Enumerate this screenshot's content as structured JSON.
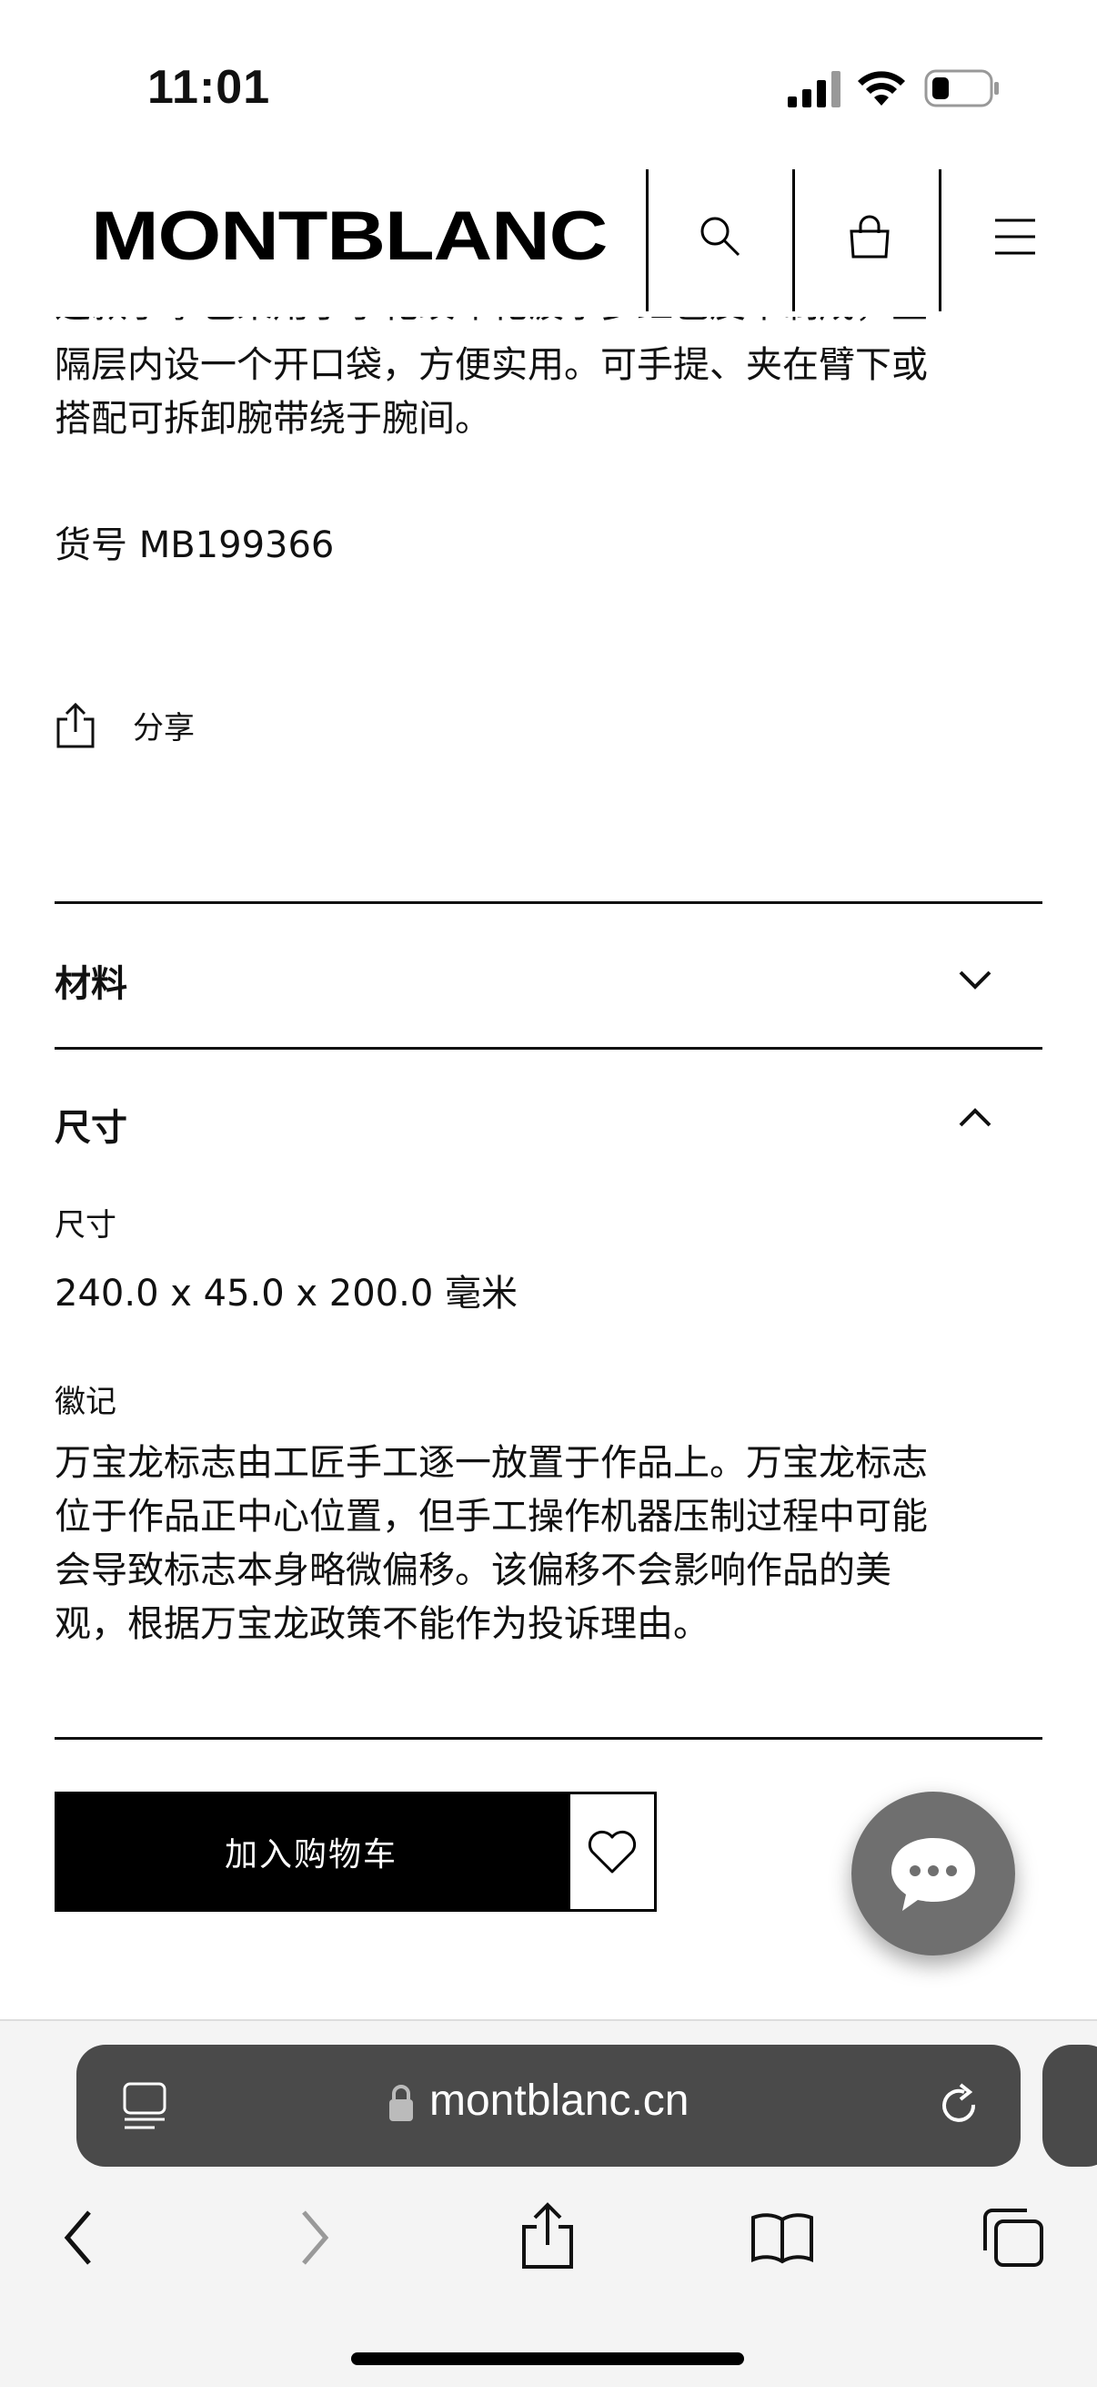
{
  "status": {
    "time": "11:01"
  },
  "header": {
    "logo": "MONTBLANC"
  },
  "description": {
    "clipped_line": "这款手拿包采用了手花纹印花波尔多红色皮革制成，主",
    "lines": [
      "隔层内设一个开口袋，方便实用。可手提、夹在臂下或",
      "搭配可拆卸腕带绕于腕间。"
    ]
  },
  "sku": "货号 MB199366",
  "share_label": "分享",
  "accordion": {
    "materials": {
      "title": "材料"
    },
    "size": {
      "title": "尺寸",
      "size_label": "尺寸",
      "size_value": "240.0 x 45.0 x 200.0 毫米",
      "emblem_label": "徽记",
      "emblem_lines": [
        "万宝龙标志由工匠手工逐一放置于作品上。万宝龙标志",
        "位于作品正中心位置，但手工操作机器压制过程中可能",
        "会导致标志本身略微偏移。该偏移不会影响作品的美",
        "观，根据万宝龙政策不能作为投诉理由。"
      ]
    }
  },
  "actions": {
    "add_to_cart": "加入购物车"
  },
  "browser": {
    "url": "montblanc.cn"
  },
  "colors": {
    "accent": "#000000",
    "chat_bubble": "#6f6f6f",
    "url_bar": "#4a4a4a"
  }
}
